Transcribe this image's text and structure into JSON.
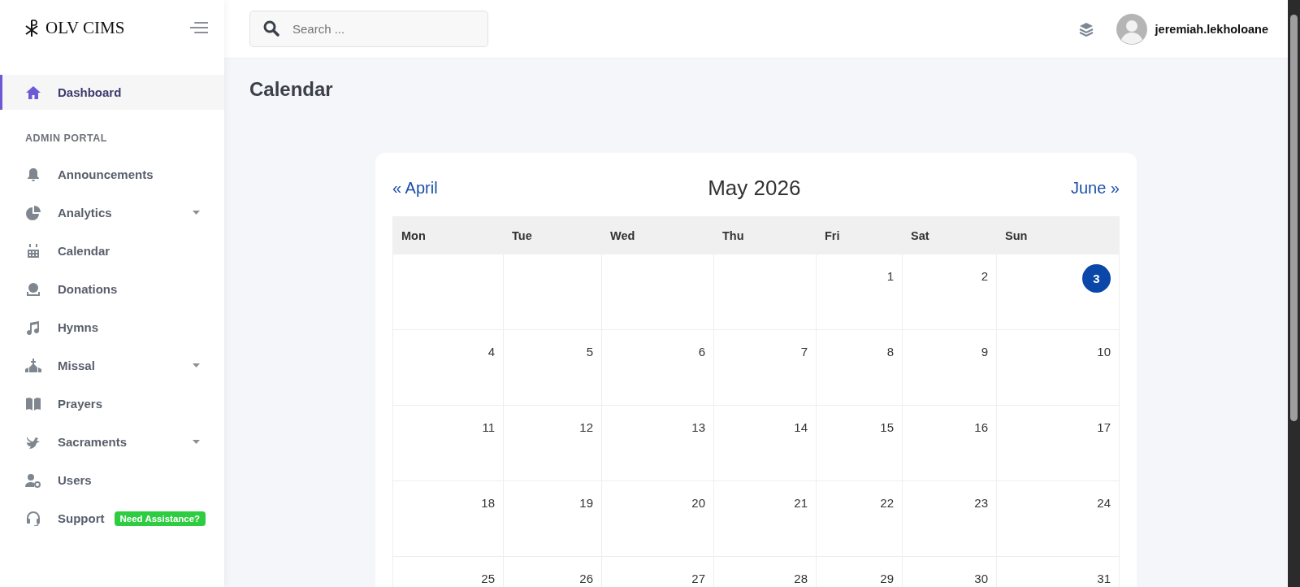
{
  "brand": {
    "name": "OLV CIMS"
  },
  "sidebar": {
    "top_items": [
      {
        "label": "Dashboard",
        "selected": true,
        "has_submenu": false
      }
    ],
    "section_title": "ADMIN PORTAL",
    "items": [
      {
        "label": "Announcements",
        "selected": false,
        "has_submenu": false
      },
      {
        "label": "Analytics",
        "selected": false,
        "has_submenu": true
      },
      {
        "label": "Calendar",
        "selected": false,
        "has_submenu": false
      },
      {
        "label": "Donations",
        "selected": false,
        "has_submenu": false
      },
      {
        "label": "Hymns",
        "selected": false,
        "has_submenu": false
      },
      {
        "label": "Missal",
        "selected": false,
        "has_submenu": true
      },
      {
        "label": "Prayers",
        "selected": false,
        "has_submenu": false
      },
      {
        "label": "Sacraments",
        "selected": false,
        "has_submenu": true
      },
      {
        "label": "Users",
        "selected": false,
        "has_submenu": false
      },
      {
        "label": "Support",
        "selected": false,
        "has_submenu": false,
        "badge": "Need Assistance?"
      }
    ]
  },
  "header": {
    "search": {
      "placeholder": "Search ..."
    },
    "user": {
      "name": "jeremiah.lekholoane"
    }
  },
  "page_title": "Calendar",
  "calendar": {
    "prev": "« April",
    "title": "May 2026",
    "next": "June »",
    "weekdays": [
      "Mon",
      "Tue",
      "Wed",
      "Thu",
      "Fri",
      "Sat",
      "Sun"
    ],
    "weeks": [
      [
        {
          "day": "1",
          "today": false
        },
        {
          "day": "2",
          "today": false
        },
        {
          "day": "3",
          "today": true
        }
      ],
      [
        {
          "day": "4",
          "today": false
        },
        {
          "day": "5",
          "today": false
        },
        {
          "day": "6",
          "today": false
        },
        {
          "day": "7",
          "today": false
        },
        {
          "day": "8",
          "today": false
        },
        {
          "day": "9",
          "today": false
        },
        {
          "day": "10",
          "today": false
        }
      ],
      [
        {
          "day": "11",
          "today": false
        },
        {
          "day": "12",
          "today": false
        },
        {
          "day": "13",
          "today": false
        },
        {
          "day": "14",
          "today": false
        },
        {
          "day": "15",
          "today": false
        },
        {
          "day": "16",
          "today": false
        },
        {
          "day": "17",
          "today": false
        }
      ],
      [
        {
          "day": "18",
          "today": false
        },
        {
          "day": "19",
          "today": false
        },
        {
          "day": "20",
          "today": false
        },
        {
          "day": "21",
          "today": false
        },
        {
          "day": "22",
          "today": false
        },
        {
          "day": "23",
          "today": false
        },
        {
          "day": "24",
          "today": false
        }
      ],
      [
        {
          "day": "25",
          "today": false
        },
        {
          "day": "26",
          "today": false
        },
        {
          "day": "27",
          "today": false
        },
        {
          "day": "28",
          "today": false
        },
        {
          "day": "29",
          "today": false
        },
        {
          "day": "30",
          "today": false
        },
        {
          "day": "31",
          "today": false
        }
      ]
    ]
  }
}
